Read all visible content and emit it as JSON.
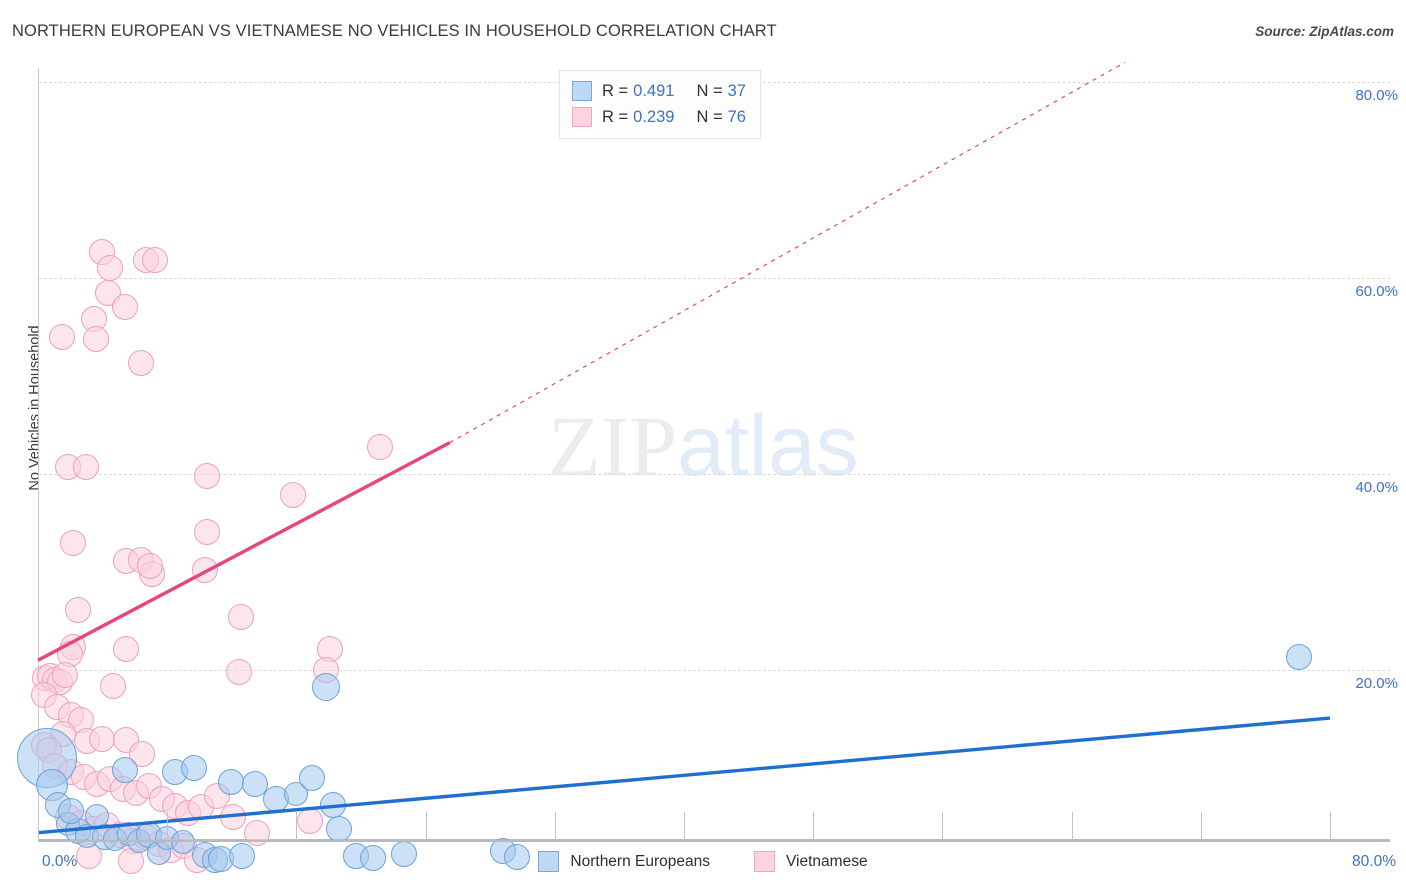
{
  "header": {
    "title": "NORTHERN EUROPEAN VS VIETNAMESE NO VEHICLES IN HOUSEHOLD CORRELATION CHART",
    "source": "Source: ZipAtlas.com"
  },
  "watermark": {
    "part1": "ZIP",
    "part2": "atlas"
  },
  "stats": {
    "rows": [
      {
        "series": "Northern Europeans",
        "r_label": "R =",
        "r_value": "0.491",
        "n_label": "N =",
        "n_value": "37",
        "color": "#bfd9f5"
      },
      {
        "series": "Vietnamese",
        "r_label": "R =",
        "r_value": "0.239",
        "n_label": "N =",
        "n_value": "76",
        "color": "#fcd4e0"
      }
    ]
  },
  "legend": {
    "items": [
      {
        "label": "Northern Europeans",
        "color": "#bfd9f5"
      },
      {
        "label": "Vietnamese",
        "color": "#fcd4e0"
      }
    ]
  },
  "chart_data": {
    "type": "scatter",
    "title": "NORTHERN EUROPEAN VS VIETNAMESE NO VEHICLES IN HOUSEHOLD CORRELATION CHART",
    "xlabel": "",
    "ylabel": "No Vehicles in Household",
    "xlim": [
      0,
      80
    ],
    "ylim": [
      0,
      82
    ],
    "grid": true,
    "legend_position": "bottom-center",
    "x_tick_labels": [
      "0.0%",
      "80.0%"
    ],
    "y_tick_labels": [
      "20.0%",
      "40.0%",
      "60.0%",
      "80.0%"
    ],
    "y_ticks": [
      20,
      40,
      60,
      80
    ],
    "y_axis_side": "right",
    "series": [
      {
        "name": "Northern Europeans",
        "color": "#a4c8ef",
        "edge_color": "#6ba3da",
        "r": 0.491,
        "n": 37,
        "trend": {
          "style": "solid",
          "color": "#1f6fd0",
          "x0": 0,
          "y0": 3.4,
          "x1": 80,
          "y1": 15.1
        },
        "points": [
          {
            "x": 0.5,
            "y": 11.0,
            "r": 30
          },
          {
            "x": 0.8,
            "y": 8.3,
            "r": 16
          },
          {
            "x": 1.2,
            "y": 6.2,
            "r": 13
          },
          {
            "x": 1.8,
            "y": 4.3,
            "r": 12
          },
          {
            "x": 2.4,
            "y": 3.6,
            "r": 13
          },
          {
            "x": 3.0,
            "y": 3.1,
            "r": 12
          },
          {
            "x": 3.6,
            "y": 5.1,
            "r": 12
          },
          {
            "x": 4.1,
            "y": 3.0,
            "r": 13
          },
          {
            "x": 4.7,
            "y": 2.8,
            "r": 12
          },
          {
            "x": 5.3,
            "y": 9.8,
            "r": 13
          },
          {
            "x": 5.6,
            "y": 3.3,
            "r": 12
          },
          {
            "x": 6.2,
            "y": 2.6,
            "r": 12
          },
          {
            "x": 6.8,
            "y": 3.2,
            "r": 13
          },
          {
            "x": 7.4,
            "y": 1.3,
            "r": 12
          },
          {
            "x": 7.9,
            "y": 2.9,
            "r": 12
          },
          {
            "x": 8.4,
            "y": 9.6,
            "r": 13
          },
          {
            "x": 8.9,
            "y": 2.5,
            "r": 12
          },
          {
            "x": 9.6,
            "y": 10.0,
            "r": 13
          },
          {
            "x": 10.3,
            "y": 1.1,
            "r": 13
          },
          {
            "x": 10.9,
            "y": 0.6,
            "r": 13
          },
          {
            "x": 11.3,
            "y": 0.7,
            "r": 13
          },
          {
            "x": 11.9,
            "y": 8.6,
            "r": 13
          },
          {
            "x": 12.6,
            "y": 1.0,
            "r": 13
          },
          {
            "x": 13.4,
            "y": 8.4,
            "r": 13
          },
          {
            "x": 14.7,
            "y": 6.8,
            "r": 13
          },
          {
            "x": 15.9,
            "y": 7.3,
            "r": 12
          },
          {
            "x": 16.9,
            "y": 9.0,
            "r": 13
          },
          {
            "x": 17.8,
            "y": 18.3,
            "r": 14
          },
          {
            "x": 18.2,
            "y": 6.2,
            "r": 13
          },
          {
            "x": 18.6,
            "y": 3.8,
            "r": 13
          },
          {
            "x": 19.6,
            "y": 1.0,
            "r": 13
          },
          {
            "x": 20.7,
            "y": 0.8,
            "r": 13
          },
          {
            "x": 22.6,
            "y": 1.2,
            "r": 13
          },
          {
            "x": 28.7,
            "y": 1.5,
            "r": 13
          },
          {
            "x": 29.6,
            "y": 0.9,
            "r": 13
          },
          {
            "x": 78.0,
            "y": 21.3,
            "r": 13
          },
          {
            "x": 2.0,
            "y": 5.6,
            "r": 13
          }
        ]
      },
      {
        "name": "Vietnamese",
        "color": "#fccfde",
        "edge_color": "#f0a0bd",
        "r": 0.239,
        "n": 76,
        "trend": {
          "style": "solid-then-dashed",
          "color": "#e8447f",
          "x0": 0,
          "y0": 21.0,
          "x1": 25.5,
          "y1": 43.2,
          "dash_x1": 67.3,
          "dash_y1": 82.0
        },
        "points": [
          {
            "x": 1.4,
            "y": 54.0,
            "r": 13
          },
          {
            "x": 3.9,
            "y": 62.7,
            "r": 13
          },
          {
            "x": 4.4,
            "y": 61.0,
            "r": 13
          },
          {
            "x": 4.3,
            "y": 58.5,
            "r": 13
          },
          {
            "x": 6.6,
            "y": 61.8,
            "r": 13
          },
          {
            "x": 7.2,
            "y": 61.8,
            "r": 13
          },
          {
            "x": 5.3,
            "y": 57.0,
            "r": 13
          },
          {
            "x": 3.4,
            "y": 55.8,
            "r": 13
          },
          {
            "x": 3.5,
            "y": 53.8,
            "r": 13
          },
          {
            "x": 6.3,
            "y": 51.3,
            "r": 13
          },
          {
            "x": 1.8,
            "y": 40.7,
            "r": 13
          },
          {
            "x": 2.9,
            "y": 40.7,
            "r": 13
          },
          {
            "x": 10.4,
            "y": 39.8,
            "r": 13
          },
          {
            "x": 15.7,
            "y": 37.9,
            "r": 13
          },
          {
            "x": 21.1,
            "y": 42.8,
            "r": 13
          },
          {
            "x": 2.1,
            "y": 33.0,
            "r": 13
          },
          {
            "x": 10.4,
            "y": 34.1,
            "r": 13
          },
          {
            "x": 5.4,
            "y": 31.1,
            "r": 13
          },
          {
            "x": 6.3,
            "y": 31.2,
            "r": 13
          },
          {
            "x": 7.0,
            "y": 29.8,
            "r": 13
          },
          {
            "x": 6.9,
            "y": 30.6,
            "r": 13
          },
          {
            "x": 10.3,
            "y": 30.2,
            "r": 13
          },
          {
            "x": 2.4,
            "y": 26.1,
            "r": 13
          },
          {
            "x": 12.5,
            "y": 25.4,
            "r": 13
          },
          {
            "x": 2.1,
            "y": 22.3,
            "r": 13
          },
          {
            "x": 1.9,
            "y": 21.6,
            "r": 13
          },
          {
            "x": 5.4,
            "y": 22.1,
            "r": 13
          },
          {
            "x": 12.4,
            "y": 19.8,
            "r": 13
          },
          {
            "x": 18.0,
            "y": 22.1,
            "r": 13
          },
          {
            "x": 17.8,
            "y": 20.0,
            "r": 13
          },
          {
            "x": 0.4,
            "y": 19.2,
            "r": 13
          },
          {
            "x": 0.7,
            "y": 19.4,
            "r": 13
          },
          {
            "x": 1.0,
            "y": 19.0,
            "r": 13
          },
          {
            "x": 1.3,
            "y": 18.8,
            "r": 13
          },
          {
            "x": 1.6,
            "y": 19.5,
            "r": 13
          },
          {
            "x": 4.6,
            "y": 18.4,
            "r": 13
          },
          {
            "x": 0.3,
            "y": 17.4,
            "r": 13
          },
          {
            "x": 1.1,
            "y": 16.2,
            "r": 13
          },
          {
            "x": 2.0,
            "y": 15.4,
            "r": 13
          },
          {
            "x": 2.6,
            "y": 14.9,
            "r": 13
          },
          {
            "x": 1.5,
            "y": 13.5,
            "r": 13
          },
          {
            "x": 0.3,
            "y": 12.3,
            "r": 13
          },
          {
            "x": 0.6,
            "y": 11.8,
            "r": 13
          },
          {
            "x": 3.0,
            "y": 12.8,
            "r": 13
          },
          {
            "x": 3.9,
            "y": 13.0,
            "r": 13
          },
          {
            "x": 5.4,
            "y": 12.9,
            "r": 13
          },
          {
            "x": 6.4,
            "y": 11.4,
            "r": 13
          },
          {
            "x": 1.0,
            "y": 10.2,
            "r": 13
          },
          {
            "x": 2.0,
            "y": 9.6,
            "r": 13
          },
          {
            "x": 2.8,
            "y": 9.1,
            "r": 13
          },
          {
            "x": 3.6,
            "y": 8.4,
            "r": 13
          },
          {
            "x": 4.4,
            "y": 8.9,
            "r": 13
          },
          {
            "x": 5.2,
            "y": 7.9,
            "r": 13
          },
          {
            "x": 6.0,
            "y": 7.4,
            "r": 13
          },
          {
            "x": 6.8,
            "y": 8.2,
            "r": 13
          },
          {
            "x": 7.6,
            "y": 6.8,
            "r": 13
          },
          {
            "x": 8.4,
            "y": 6.1,
            "r": 13
          },
          {
            "x": 9.2,
            "y": 5.4,
            "r": 13
          },
          {
            "x": 10.0,
            "y": 6.0,
            "r": 13
          },
          {
            "x": 1.8,
            "y": 5.0,
            "r": 13
          },
          {
            "x": 2.6,
            "y": 4.4,
            "r": 13
          },
          {
            "x": 3.4,
            "y": 3.8,
            "r": 13
          },
          {
            "x": 4.2,
            "y": 4.2,
            "r": 13
          },
          {
            "x": 5.0,
            "y": 3.2,
            "r": 13
          },
          {
            "x": 5.8,
            "y": 2.6,
            "r": 13
          },
          {
            "x": 6.6,
            "y": 3.0,
            "r": 13
          },
          {
            "x": 7.4,
            "y": 2.2,
            "r": 13
          },
          {
            "x": 8.2,
            "y": 1.6,
            "r": 13
          },
          {
            "x": 9.0,
            "y": 2.0,
            "r": 13
          },
          {
            "x": 3.1,
            "y": 1.0,
            "r": 13
          },
          {
            "x": 5.7,
            "y": 0.5,
            "r": 13
          },
          {
            "x": 9.8,
            "y": 0.6,
            "r": 13
          },
          {
            "x": 11.0,
            "y": 7.1,
            "r": 13
          },
          {
            "x": 12.0,
            "y": 5.0,
            "r": 13
          },
          {
            "x": 13.5,
            "y": 3.4,
            "r": 13
          },
          {
            "x": 16.8,
            "y": 4.6,
            "r": 13
          }
        ]
      }
    ]
  }
}
